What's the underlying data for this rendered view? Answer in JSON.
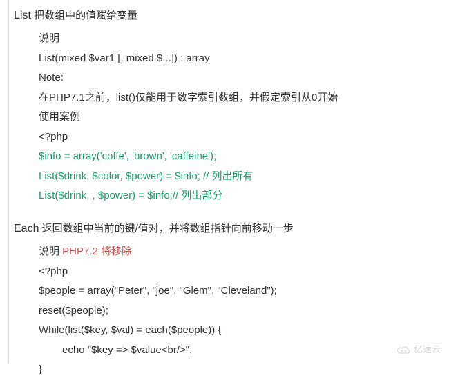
{
  "list": {
    "heading_keyword": "List",
    "heading_rest": " 把数组中的值赋给变量",
    "desc_label": "说明",
    "signature_kw": "List",
    "signature_rest": "(mixed $var1 [, mixed $...]) : array",
    "note_kw": "N",
    "note_rest": "ote:",
    "note_line": "在PHP7.1之前，list()仅能用于数字索引数组，并假定索引从0开始",
    "example_label": "使用案例",
    "php_open": "<?php",
    "code1": "$info = array('coffe', 'brown', 'caffeine');",
    "code2_kw": "List",
    "code2_rest": "($drink, $color,  $power) = $info; ",
    "code2_cmt": "// 列出所有",
    "code3_kw": "List",
    "code3_rest": "($drink, , $power) = $info;",
    "code3_cmt": "// 列出部分"
  },
  "each": {
    "heading_keyword": "Each",
    "heading_rest": " 返回数组中当前的键/值对，并将数组指针向前移动一步",
    "desc_label": "说明 ",
    "warning": "PHP7.2 将移除",
    "php_open": "<?php",
    "code1": "$people = array(\"Peter\", \"joe\", \"Glem\", \"Cleveland\");",
    "code2": "reset($people);",
    "code3": "While(list($key, $val) = each($people)) {",
    "code4": "echo \"$key => $value<br/>\";",
    "code5": "}"
  },
  "watermark": "亿速云"
}
